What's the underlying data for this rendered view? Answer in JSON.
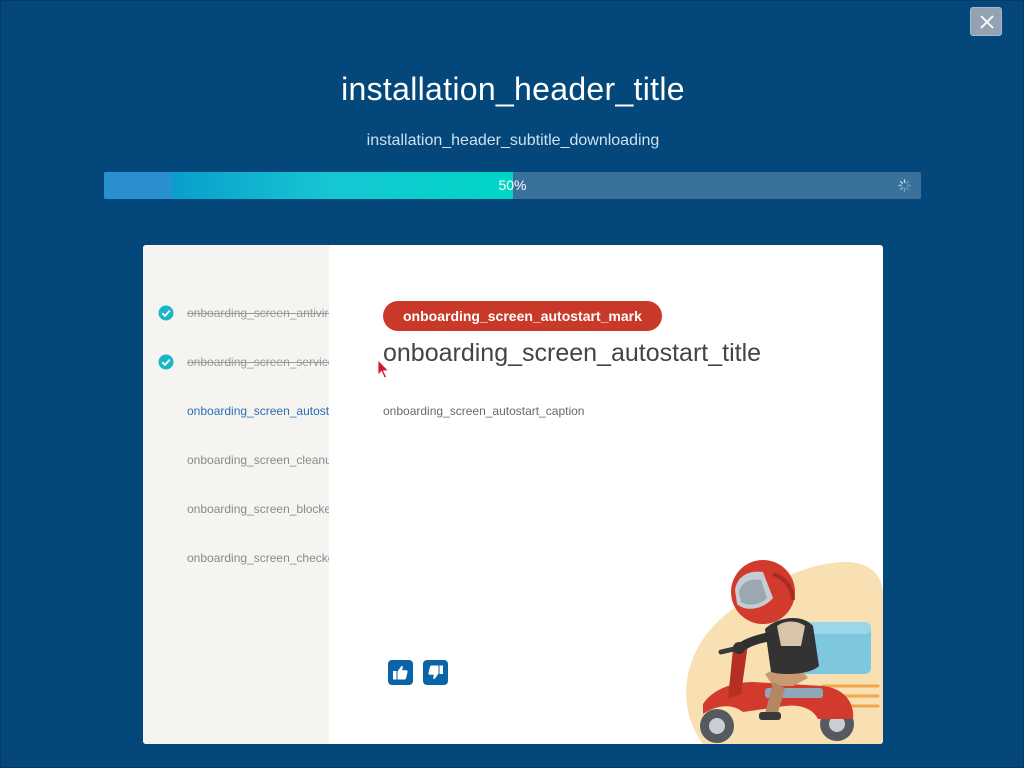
{
  "window": {
    "close_icon": "close-icon"
  },
  "header": {
    "title": "installation_header_title",
    "subtitle": "installation_header_subtitle_downloading"
  },
  "progress": {
    "value": 50,
    "label": "50%",
    "spinner_icon": "spinner-icon"
  },
  "sidebar": {
    "steps": [
      {
        "label": "onboarding_screen_antivirus_title",
        "state": "done"
      },
      {
        "label": "onboarding_screen_services_title",
        "state": "done"
      },
      {
        "label": "onboarding_screen_autostart_title",
        "state": "active"
      },
      {
        "label": "onboarding_screen_cleanup_title",
        "state": "pending"
      },
      {
        "label": "onboarding_screen_blocker_title",
        "state": "pending"
      },
      {
        "label": "onboarding_screen_checker_title",
        "state": "pending"
      }
    ]
  },
  "content": {
    "mark": "onboarding_screen_autostart_mark",
    "title": "onboarding_screen_autostart_title",
    "caption": "onboarding_screen_autostart_caption",
    "thumbs_up_icon": "thumbs-up-icon",
    "thumbs_down_icon": "thumbs-down-icon"
  },
  "colors": {
    "background": "#04477a",
    "accent_teal": "#00d6c6",
    "mark_red": "#c8392a",
    "check_teal": "#19b6c4",
    "link_blue": "#2a6fb0"
  }
}
